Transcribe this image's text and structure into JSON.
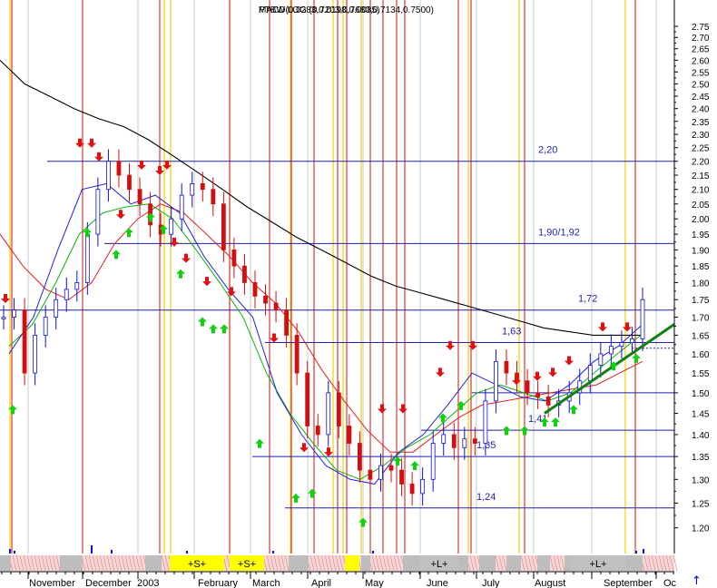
{
  "chart_data": {
    "type": "line",
    "title": "PTBW LOG (0.7203,0.7680,0.7134,0.7500)",
    "subtitle": "MACD(0.0283,0.0198,0.0085)",
    "x_axis": {
      "months": [
        "November",
        "December",
        "2003",
        "February",
        "March",
        "April",
        "May",
        "June",
        "July",
        "August",
        "September",
        "Oc"
      ]
    },
    "y_axis": {
      "scale": "log",
      "ylim": [
        1.15,
        2.8
      ],
      "ticks": [
        "2.75",
        "2.70",
        "2.65",
        "2.60",
        "2.55",
        "2.50",
        "2.45",
        "2.40",
        "2.35",
        "2.30",
        "2.25",
        "2.20",
        "2.15",
        "2.10",
        "2.05",
        "2.00",
        "1.95",
        "1.90",
        "1.85",
        "1.80",
        "1.75",
        "1.70",
        "1.65",
        "1.60",
        "1.55",
        "1.50",
        "1.45",
        "1.40",
        "1.35",
        "1.30",
        "1.25",
        "1.20"
      ]
    },
    "levels": [
      {
        "label": "2,20",
        "value": 2.2
      },
      {
        "label": "1,90/1,92",
        "value": 1.92
      },
      {
        "label": "1,72",
        "value": 1.72
      },
      {
        "label": "1,63",
        "value": 1.63
      },
      {
        "label": "1,41",
        "value": 1.41
      },
      {
        "label": "1,35",
        "value": 1.35
      },
      {
        "label": "1,24",
        "value": 1.24
      }
    ],
    "extra_levels": [
      1.5
    ],
    "price_series": [
      1.7,
      1.72,
      1.55,
      1.65,
      1.7,
      1.75,
      1.78,
      1.8,
      1.95,
      2.1,
      2.2,
      2.15,
      2.1,
      2.05,
      1.98,
      1.95,
      2.0,
      2.08,
      2.12,
      2.1,
      2.05,
      1.9,
      1.85,
      1.8,
      1.76,
      1.74,
      1.72,
      1.65,
      1.55,
      1.42,
      1.4,
      1.5,
      1.42,
      1.38,
      1.32,
      1.3,
      1.33,
      1.32,
      1.29,
      1.27,
      1.3,
      1.38,
      1.4,
      1.37,
      1.39,
      1.38,
      1.48,
      1.58,
      1.55,
      1.53,
      1.5,
      1.49,
      1.47,
      1.48,
      1.5,
      1.53,
      1.57,
      1.6,
      1.62,
      1.63,
      1.64,
      1.75
    ],
    "ma_series": [
      {
        "color": "#000000",
        "values": [
          2.6,
          2.5,
          2.45,
          2.4,
          2.36,
          2.33,
          2.28,
          2.22,
          2.16,
          2.1,
          2.04,
          1.99,
          1.94,
          1.9,
          1.86,
          1.82,
          1.79,
          1.77,
          1.75,
          1.73,
          1.71,
          1.69,
          1.67,
          1.66,
          1.65,
          1.65,
          1.65
        ]
      },
      {
        "color": "#e02020",
        "values": [
          1.95,
          1.85,
          1.78,
          1.75,
          1.8,
          1.92,
          2.0,
          2.05,
          2.02,
          1.95,
          1.88,
          1.8,
          1.74,
          1.66,
          1.56,
          1.48,
          1.41,
          1.36,
          1.36,
          1.4,
          1.44,
          1.47,
          1.48,
          1.49,
          1.5,
          1.51,
          1.52,
          1.55,
          1.58
        ]
      },
      {
        "color": "#10b010",
        "values": [
          1.62,
          1.68,
          1.8,
          1.95,
          2.02,
          2.04,
          2.05,
          2.0,
          1.9,
          1.8,
          1.7,
          1.55,
          1.45,
          1.38,
          1.32,
          1.3,
          1.33,
          1.37,
          1.4,
          1.45,
          1.5,
          1.52,
          1.5,
          1.48,
          1.5,
          1.55,
          1.6,
          1.65
        ]
      },
      {
        "color": "#2020e0",
        "values": [
          1.6,
          1.7,
          1.9,
          2.1,
          2.12,
          2.05,
          2.08,
          2.02,
          1.88,
          1.78,
          1.7,
          1.5,
          1.4,
          1.33,
          1.3,
          1.29,
          1.36,
          1.4,
          1.47,
          1.55,
          1.52,
          1.49,
          1.48,
          1.52,
          1.58,
          1.62,
          1.68
        ]
      }
    ],
    "trend_line": {
      "color": "#108010",
      "from": 1.45,
      "to": 1.68
    },
    "volume_bands": [
      {
        "label": "+S+"
      },
      {
        "label": "+S+"
      },
      {
        "label": "+L+"
      },
      {
        "label": "+L+"
      }
    ]
  }
}
